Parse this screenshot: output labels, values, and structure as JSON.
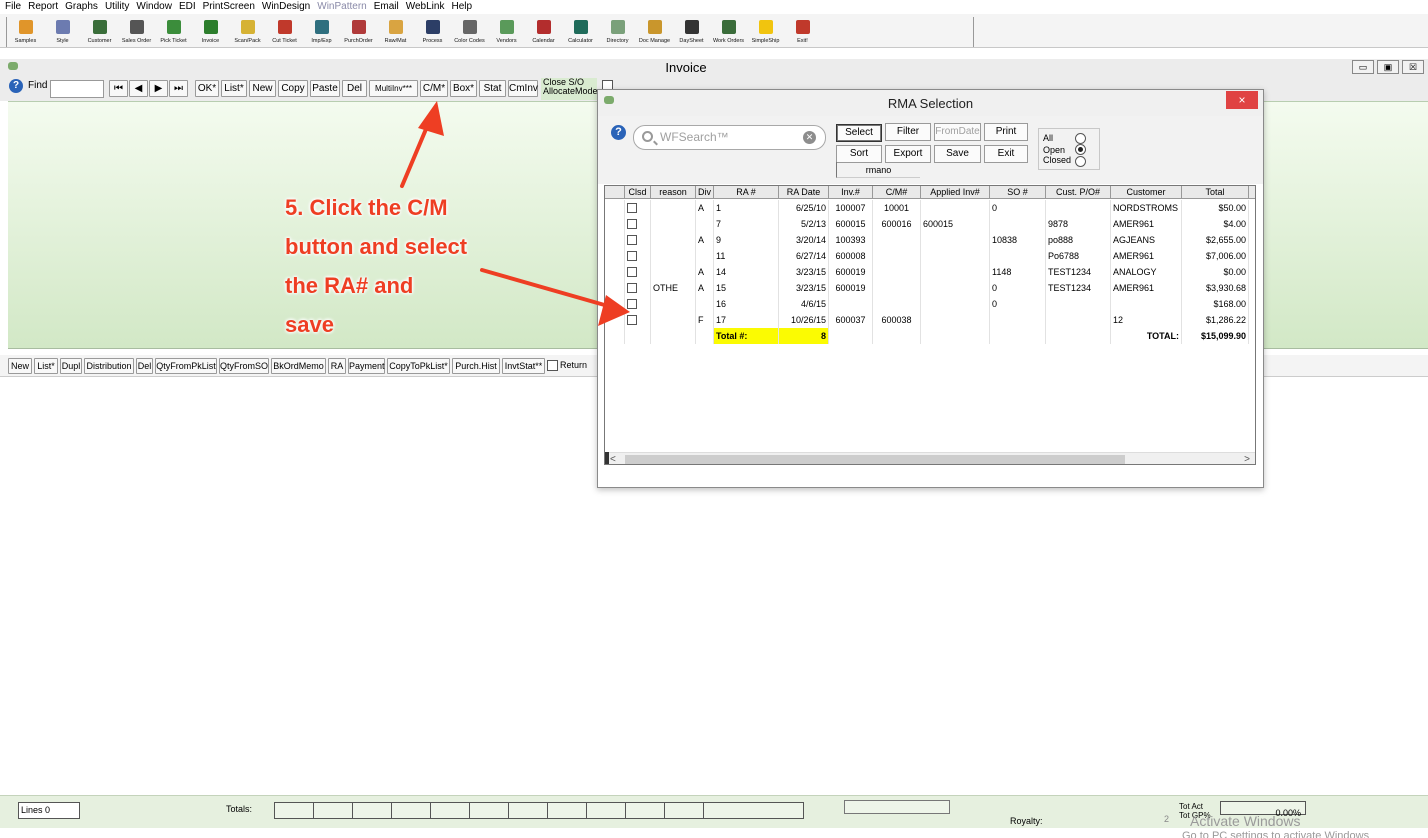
{
  "menu": [
    "File",
    "Report",
    "Graphs",
    "Utility",
    "Window",
    "EDI",
    "PrintScreen",
    "WinDesign",
    "WinPattern",
    "Email",
    "WebLink",
    "Help"
  ],
  "toolbar": [
    {
      "label": "Samples",
      "icon": "samples-icon",
      "color": "#e0952a"
    },
    {
      "label": "Style",
      "icon": "style-icon",
      "color": "#6c7bb0"
    },
    {
      "label": "Customer",
      "icon": "customer-icon",
      "color": "#3a6e3a"
    },
    {
      "label": "Sales Order",
      "icon": "sales-order-icon",
      "color": "#555555"
    },
    {
      "label": "Pick Ticket",
      "icon": "pick-ticket-icon",
      "color": "#3b8d3b"
    },
    {
      "label": "Invoice",
      "icon": "invoice-icon",
      "color": "#2c7d2c"
    },
    {
      "label": "Scan/Pack",
      "icon": "scan-pack-icon",
      "color": "#d6b234"
    },
    {
      "label": "Cut Ticket",
      "icon": "cut-ticket-icon",
      "color": "#c0392b"
    },
    {
      "label": "Imp/Exp",
      "icon": "imp-exp-icon",
      "color": "#2f6f7f"
    },
    {
      "label": "PurchOrder",
      "icon": "purch-order-icon",
      "color": "#b03a3a"
    },
    {
      "label": "Raw/Mat",
      "icon": "raw-mat-icon",
      "color": "#d9a441"
    },
    {
      "label": "Process",
      "icon": "process-icon",
      "color": "#2c3e66"
    },
    {
      "label": "Color Codes",
      "icon": "color-codes-icon",
      "color": "#666666"
    },
    {
      "label": "Vendors",
      "icon": "vendors-icon",
      "color": "#5a9a5a"
    },
    {
      "label": "Calendar",
      "icon": "calendar-icon",
      "color": "#b32d2d"
    },
    {
      "label": "Calculator",
      "icon": "calculator-icon",
      "color": "#1f6b5a"
    },
    {
      "label": "Directory",
      "icon": "directory-icon",
      "color": "#7aa07a"
    },
    {
      "label": "Doc Manage",
      "icon": "doc-manage-icon",
      "color": "#c9962c"
    },
    {
      "label": "DaySheet",
      "icon": "daysheet-icon",
      "color": "#333333"
    },
    {
      "label": "Work Orders",
      "icon": "work-orders-icon",
      "color": "#3a6c3a"
    },
    {
      "label": "SimpleShip",
      "icon": "simpleship-icon",
      "color": "#f1c40f"
    },
    {
      "label": "Exit!",
      "icon": "exit-icon",
      "color": "#c0392b"
    }
  ],
  "window": {
    "title": "Invoice",
    "min": "▭",
    "max": "▣",
    "close": "☒"
  },
  "invoice_bar": {
    "find_label": "Find",
    "nav": [
      "⏮",
      "◀",
      "▶",
      "⏭"
    ],
    "buttons": [
      "OK*",
      "List*",
      "New",
      "Copy",
      "Paste",
      "Del",
      "MultiInv***",
      "C/M*",
      "Box*",
      "Stat",
      "CmInv"
    ],
    "close_so": "Close S/O",
    "allocate_mode": "AllocateMode"
  },
  "lower_bar": {
    "buttons": [
      "New",
      "List*",
      "Dupl",
      "Distribution",
      "Del",
      "QtyFromPkList",
      "QtyFromSO",
      "BkOrdMemo",
      "RA",
      "Payment",
      "CopyToPkList*",
      "Purch.Hist",
      "InvtStat**"
    ],
    "return_label": "Return"
  },
  "annotation": {
    "lines": [
      "5. Click the C/M",
      "button and select",
      "the RA#  and",
      "save"
    ],
    "color": "#ee3e23"
  },
  "footer": {
    "lines_label": "Lines",
    "lines_value": "0",
    "totals_label": "Totals:",
    "royalty_label": "Royalty:",
    "tot_act_label": "Tot Act",
    "tot_gp_label": "Tot GP%",
    "tot_gp_value": "0.00%",
    "page_num": "2",
    "watermark": "Activate Windows",
    "watermark2": "Go to PC settings to activate Windows"
  },
  "rma": {
    "title": "RMA Selection",
    "close": "×",
    "search_placeholder": "WFSearch™",
    "buttons": {
      "select": "Select",
      "filter": "Filter",
      "from_date": "FromDate",
      "print": "Print",
      "sort": "Sort",
      "export": "Export",
      "save": "Save",
      "exit": "Exit"
    },
    "user": "rmano",
    "radios": [
      {
        "label": "All",
        "on": false
      },
      {
        "label": "Open",
        "on": true
      },
      {
        "label": "Closed",
        "on": false
      }
    ],
    "columns": [
      "",
      "Clsd",
      "reason",
      "Div",
      "RA #",
      "RA Date",
      "Inv.#",
      "C/M#",
      "Applied Inv#",
      "SO #",
      "Cust. P/O#",
      "Customer",
      "Total",
      ""
    ],
    "rows": [
      {
        "reason": "",
        "div": "A",
        "ra": "1",
        "date": "6/25/10",
        "inv": "100007",
        "cm": "10001",
        "applied": "",
        "so": "0",
        "po": "",
        "customer": "NORDSTROMS",
        "total": "$50.00"
      },
      {
        "reason": "",
        "div": "",
        "ra": "7",
        "date": "5/2/13",
        "inv": "600015",
        "cm": "600016",
        "applied": "600015",
        "so": "",
        "po": "9878",
        "customer": "AMER961",
        "total": "$4.00"
      },
      {
        "reason": "",
        "div": "A",
        "ra": "9",
        "date": "3/20/14",
        "inv": "100393",
        "cm": "",
        "applied": "",
        "so": "10838",
        "po": "po888",
        "customer": "AGJEANS",
        "total": "$2,655.00"
      },
      {
        "reason": "",
        "div": "",
        "ra": "11",
        "date": "6/27/14",
        "inv": "600008",
        "cm": "",
        "applied": "",
        "so": "",
        "po": "Po6788",
        "customer": "AMER961",
        "total": "$7,006.00"
      },
      {
        "reason": "",
        "div": "A",
        "ra": "14",
        "date": "3/23/15",
        "inv": "600019",
        "cm": "",
        "applied": "",
        "so": "1148",
        "po": "TEST1234",
        "customer": "ANALOGY",
        "total": "$0.00"
      },
      {
        "reason": "OTHE",
        "div": "A",
        "ra": "15",
        "date": "3/23/15",
        "inv": "600019",
        "cm": "",
        "applied": "",
        "so": "0",
        "po": "TEST1234",
        "customer": "AMER961",
        "total": "$3,930.68"
      },
      {
        "reason": "",
        "div": "",
        "ra": "16",
        "date": "4/6/15",
        "inv": "",
        "cm": "",
        "applied": "",
        "so": "0",
        "po": "",
        "customer": "",
        "total": "$168.00"
      },
      {
        "reason": "",
        "div": "F",
        "ra": "17",
        "date": "10/26/15",
        "inv": "600037",
        "cm": "600038",
        "applied": "",
        "so": "",
        "po": "",
        "customer": "12",
        "total": "$1,286.22"
      }
    ],
    "total_label": "Total #:",
    "total_count": "8",
    "grand_label": "TOTAL:",
    "grand_total": "$15,099.90",
    "scroll_left": "<",
    "scroll_right": ">"
  }
}
